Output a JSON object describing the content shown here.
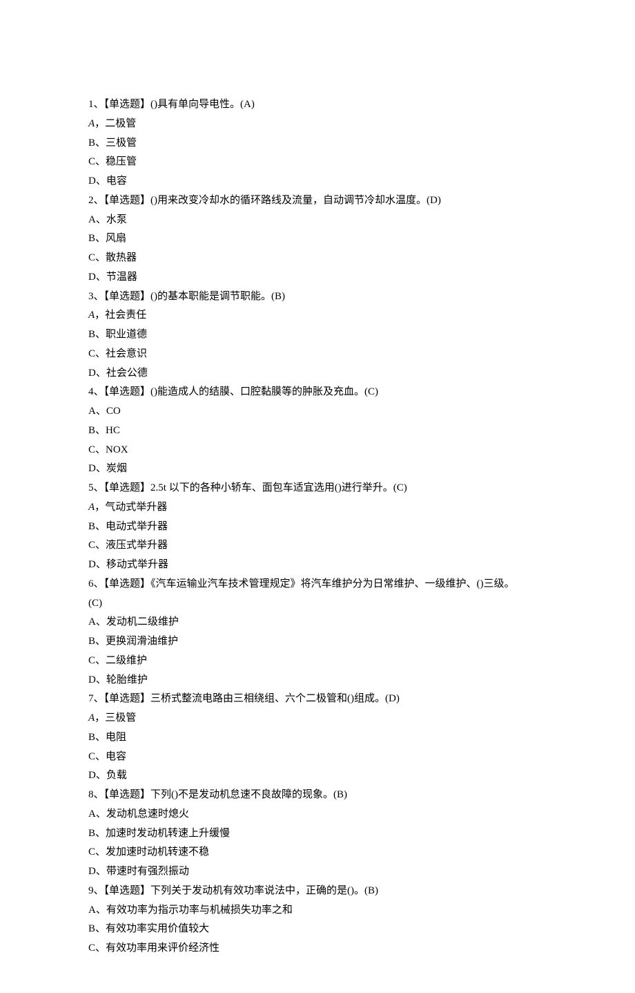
{
  "questions": [
    {
      "num": "1",
      "type_label": "【单选题】",
      "stem": "()具有单向导电性。",
      "answer": "(A)",
      "options": [
        {
          "letter": "A",
          "italic": true,
          "sep": "，",
          "text": "二极管"
        },
        {
          "letter": "B",
          "italic": false,
          "sep": "、",
          "text": "三极管"
        },
        {
          "letter": "C",
          "italic": false,
          "sep": "、",
          "text": "稳压管"
        },
        {
          "letter": "D",
          "italic": false,
          "sep": "、",
          "text": "电容"
        }
      ]
    },
    {
      "num": "2",
      "type_label": "【单选题】",
      "stem": "()用来改变冷却水的循环路线及流量，自动调节冷却水温度。",
      "answer": "(D)",
      "options": [
        {
          "letter": "A",
          "italic": false,
          "sep": "、",
          "text": "水泵"
        },
        {
          "letter": "B",
          "italic": false,
          "sep": "、",
          "text": "风扇"
        },
        {
          "letter": "C",
          "italic": false,
          "sep": "、",
          "text": "散热器"
        },
        {
          "letter": "D",
          "italic": false,
          "sep": "、",
          "text": "节温器"
        }
      ]
    },
    {
      "num": "3",
      "type_label": "【单选题】",
      "stem": "()的基本职能是调节职能。",
      "answer": "(B)",
      "options": [
        {
          "letter": "A",
          "italic": true,
          "sep": "，",
          "text": "社会责任"
        },
        {
          "letter": "B",
          "italic": false,
          "sep": "、",
          "text": "职业道德"
        },
        {
          "letter": "C",
          "italic": false,
          "sep": "、",
          "text": "社会意识"
        },
        {
          "letter": "D",
          "italic": false,
          "sep": "、",
          "text": "社会公德"
        }
      ]
    },
    {
      "num": "4",
      "type_label": "【单选题】",
      "stem": "()能造成人的结膜、口腔黏膜等的肿胀及充血。",
      "answer": "(C)",
      "options": [
        {
          "letter": "A",
          "italic": false,
          "sep": "、",
          "text": "CO"
        },
        {
          "letter": "B",
          "italic": false,
          "sep": "、",
          "text": "HC"
        },
        {
          "letter": "C",
          "italic": false,
          "sep": "、",
          "text": "NOX"
        },
        {
          "letter": "D",
          "italic": false,
          "sep": "、",
          "text": "炭烟"
        }
      ]
    },
    {
      "num": "5",
      "type_label": "【单选题】",
      "stem": "2.5t 以下的各种小轿车、面包车适宜选用()进行举升。",
      "answer": "(C)",
      "options": [
        {
          "letter": "A",
          "italic": true,
          "sep": "，",
          "text": "气动式举升器"
        },
        {
          "letter": "B",
          "italic": false,
          "sep": "、",
          "text": "电动式举升器"
        },
        {
          "letter": "C",
          "italic": false,
          "sep": "、",
          "text": "液压式举升器"
        },
        {
          "letter": "D",
          "italic": false,
          "sep": "、",
          "text": "移动式举升器"
        }
      ]
    },
    {
      "num": "6",
      "type_label": "【单选题】",
      "stem": "《汽车运输业汽车技术管理规定》将汽车维护分为日常维护、一级维护、()三级。",
      "answer": "(C)",
      "answer_on_new_line": true,
      "options": [
        {
          "letter": "A",
          "italic": false,
          "sep": "、",
          "text": "发动机二级维护"
        },
        {
          "letter": "B",
          "italic": false,
          "sep": "、",
          "text": "更换润滑油维护"
        },
        {
          "letter": "C",
          "italic": false,
          "sep": "、",
          "text": "二级维护"
        },
        {
          "letter": "D",
          "italic": false,
          "sep": "、",
          "text": "轮胎维护"
        }
      ]
    },
    {
      "num": "7",
      "type_label": "【单选题】",
      "stem": "三桥式整流电路由三相绕组、六个二极管和()组成。",
      "answer": "(D)",
      "options": [
        {
          "letter": "A",
          "italic": true,
          "sep": "，",
          "text": "三极管"
        },
        {
          "letter": "B",
          "italic": false,
          "sep": "、",
          "text": "电阻"
        },
        {
          "letter": "C",
          "italic": false,
          "sep": "、",
          "text": "电容"
        },
        {
          "letter": "D",
          "italic": false,
          "sep": "、",
          "text": "负载"
        }
      ]
    },
    {
      "num": "8",
      "type_label": "【单选题】",
      "stem": "下列()不是发动机怠速不良故障的现象。",
      "answer": "(B)",
      "options": [
        {
          "letter": "A",
          "italic": false,
          "sep": "、",
          "text": "发动机怠速时熄火"
        },
        {
          "letter": "B",
          "italic": false,
          "sep": "、",
          "text": "加速时发动机转速上升缓慢"
        },
        {
          "letter": "C",
          "italic": false,
          "sep": "、",
          "text": "发加速时动机转速不稳"
        },
        {
          "letter": "D",
          "italic": false,
          "sep": "、",
          "text": "带速时有强烈振动"
        }
      ]
    },
    {
      "num": "9",
      "type_label": "【单选题】",
      "stem": "下列关于发动机有效功率说法中，正确的是()。",
      "answer": "(B)",
      "options": [
        {
          "letter": "A",
          "italic": false,
          "sep": "、",
          "text": "有效功率为指示功率与机械损失功率之和"
        },
        {
          "letter": "B",
          "italic": false,
          "sep": "、",
          "text": "有效功率实用价值较大"
        },
        {
          "letter": "C",
          "italic": false,
          "sep": "、",
          "text": "有效功率用来评价经济性"
        }
      ]
    }
  ]
}
